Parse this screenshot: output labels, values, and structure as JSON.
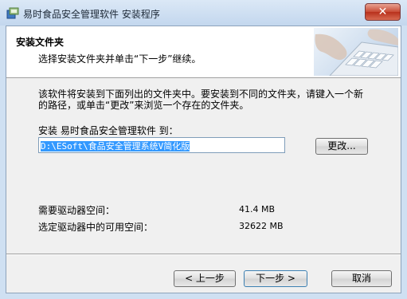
{
  "window": {
    "title": "易时食品安全管理软件 安装程序"
  },
  "header": {
    "title": "安装文件夹",
    "subtitle": "选择安装文件夹并单击“下一步”继续。"
  },
  "body": {
    "description_line1": "该软件将安装到下面列出的文件夹中。要安装到不同的文件夹，请键入一个新",
    "description_line2": "的路径，或单击“更改”来浏览一个存在的文件夹。",
    "folder_label": "安装 易时食品安全管理软件 到：",
    "install_path": "D:\\ESoft\\食品安全管理系统V简化版",
    "change_button": "更改..."
  },
  "disk": {
    "required_label": "需要驱动器空间：",
    "required_value": "41.4 MB",
    "available_label": "选定驱动器中的可用空间：",
    "available_value": "32622 MB"
  },
  "footer": {
    "back_button": "< 上一步",
    "next_button": "下一步 >",
    "cancel_button": "取消"
  },
  "icons": {
    "app": "installer-icon",
    "close": "close-icon",
    "header_image": "keyboard-image"
  },
  "colors": {
    "titlebar": "#c3d7ee",
    "close_button": "#c84b35",
    "selection": "#3399ff"
  }
}
